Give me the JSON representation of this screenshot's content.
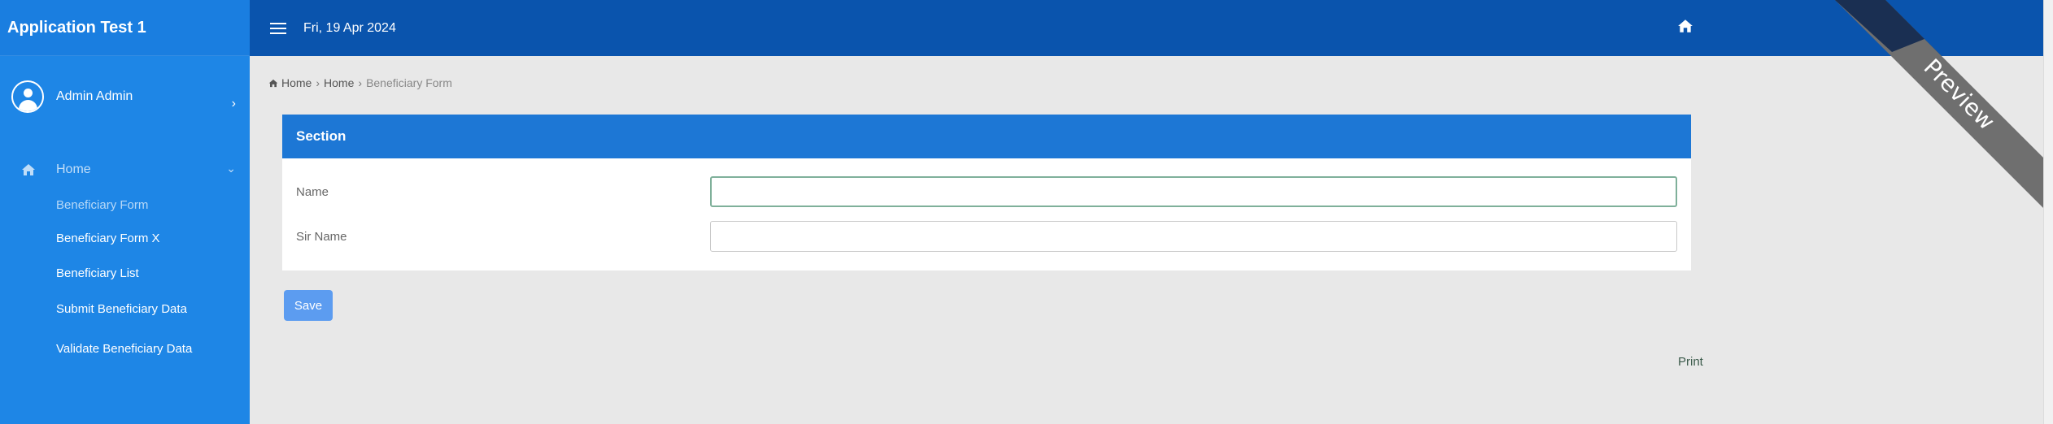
{
  "app": {
    "title": "Application Test 1"
  },
  "user": {
    "name": "Admin Admin"
  },
  "sidebar": {
    "home_label": "Home",
    "items": [
      {
        "label": "Beneficiary Form",
        "active": true
      },
      {
        "label": "Beneficiary Form X",
        "active": false
      },
      {
        "label": "Beneficiary List",
        "active": false
      },
      {
        "label": "Submit Beneficiary Data",
        "active": false
      },
      {
        "label": "Validate Beneficiary Data",
        "active": false
      }
    ]
  },
  "header": {
    "date": "Fri, 19 Apr 2024"
  },
  "breadcrumb": {
    "items": [
      "Home",
      "Home"
    ],
    "current": "Beneficiary Form"
  },
  "section": {
    "title": "Section",
    "fields": [
      {
        "label": "Name",
        "value": "",
        "placeholder": ""
      },
      {
        "label": "Sir Name",
        "value": "",
        "placeholder": ""
      }
    ]
  },
  "actions": {
    "save_label": "Save",
    "print_label": "Print"
  },
  "ribbon": {
    "label": "Preview"
  },
  "colors": {
    "sidebar": "#1e86e6",
    "header": "#0a54ad",
    "section_header": "#1d77d5",
    "save_button": "#5c9cf0",
    "ribbon": "#6f6f6f"
  }
}
